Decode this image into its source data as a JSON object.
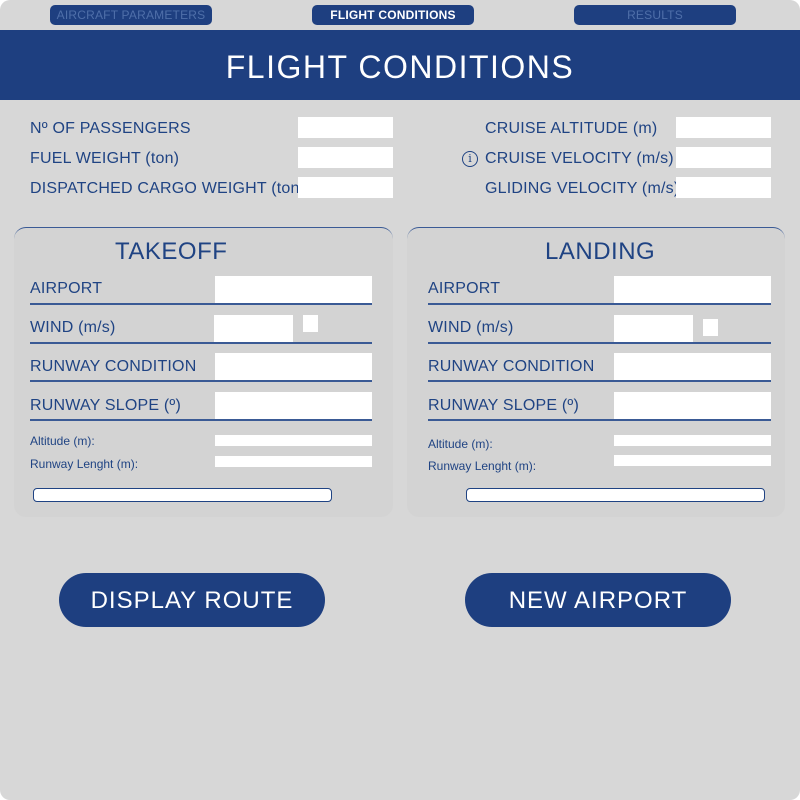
{
  "tabs": [
    {
      "label": "AIRCRAFT PARAMETERS",
      "active": false
    },
    {
      "label": "FLIGHT CONDITIONS",
      "active": true
    },
    {
      "label": "RESULTS",
      "active": false
    }
  ],
  "header": {
    "title": "FLIGHT CONDITIONS"
  },
  "general": {
    "passengers_label": "Nº OF PASSENGERS",
    "fuel_label": "FUEL WEIGHT (ton)",
    "cargo_label": "DISPATCHED CARGO WEIGHT (ton)",
    "cruise_altitude_label": "CRUISE ALTITUDE (m)",
    "cruise_velocity_label": "CRUISE VELOCITY (m/s)",
    "gliding_velocity_label": "GLIDING VELOCITY (m/s)",
    "info_icon_glyph": "i"
  },
  "takeoff": {
    "title": "TAKEOFF",
    "airport_label": "AIRPORT",
    "wind_label": "WIND (m/s)",
    "runway_condition_label": "RUNWAY CONDITION",
    "runway_slope_label": "RUNWAY SLOPE (º)",
    "altitude_label": "Altitude (m):",
    "runway_length_label": "Runway Lenght (m):"
  },
  "landing": {
    "title": "LANDING",
    "airport_label": "AIRPORT",
    "wind_label": "WIND (m/s)",
    "runway_condition_label": "RUNWAY CONDITION",
    "runway_slope_label": "RUNWAY SLOPE (º)",
    "altitude_label": "Altitude (m):",
    "runway_length_label": "Runway Lenght (m):"
  },
  "buttons": {
    "display_route": "DISPLAY ROUTE",
    "new_airport": "NEW AIRPORT"
  },
  "colors": {
    "primary": "#1e3f80",
    "text": "#1f4383",
    "background": "#d7d7d7",
    "input": "#ffffff"
  }
}
